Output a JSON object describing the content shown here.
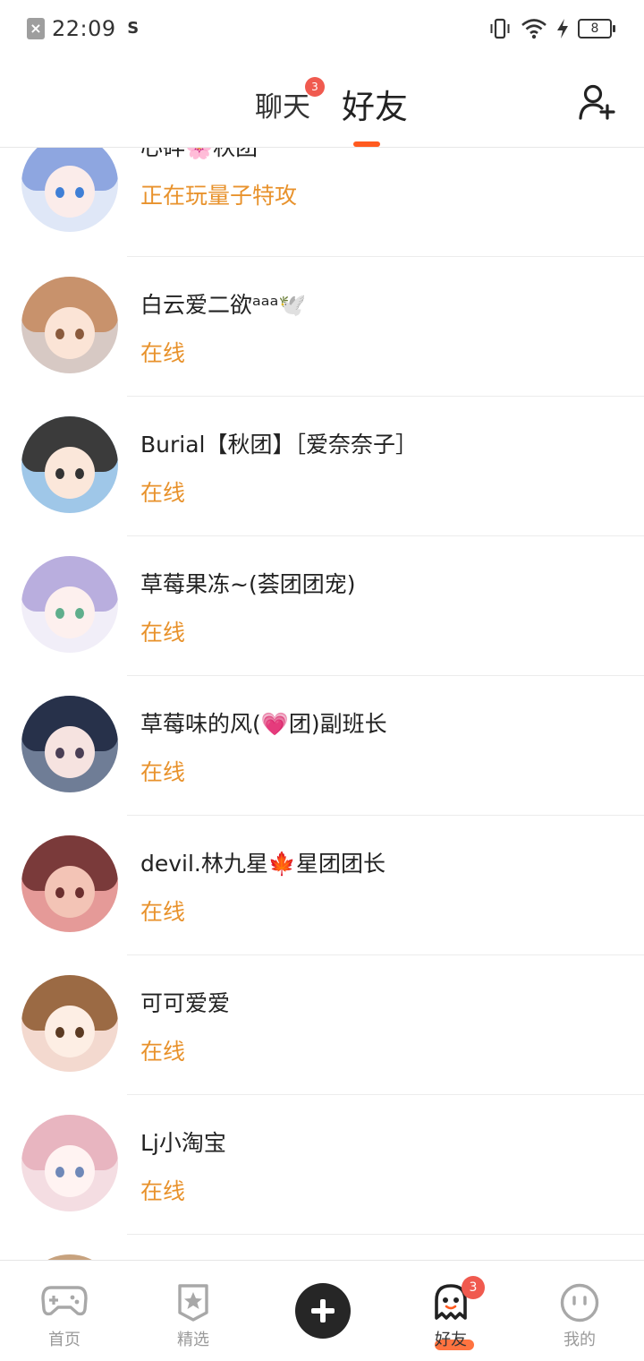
{
  "status_bar": {
    "time": "22:09",
    "battery": "8"
  },
  "header": {
    "tabs": [
      {
        "label": "聊天",
        "badge": "3",
        "active": false
      },
      {
        "label": "好友",
        "active": true
      }
    ],
    "add_friend_icon": "add-person-icon",
    "accent_color": "#ff5a1f"
  },
  "friends": [
    {
      "name": "心碎🌸秋团",
      "status": "正在玩量子特攻"
    },
    {
      "name": "白云爱二欲ᵃᵃᵃ🕊️",
      "status": "在线"
    },
    {
      "name": "Burial【秋团】［爱奈奈子］",
      "status": "在线"
    },
    {
      "name": "草莓果冻~(荟团团宠)",
      "status": "在线"
    },
    {
      "name": "草莓味的风(💗团)副班长",
      "status": "在线"
    },
    {
      "name": "devil.林九星🍁星团团长",
      "status": "在线"
    },
    {
      "name": "可可爱爱",
      "status": "在线"
    },
    {
      "name": "Lj小淘宝",
      "status": "在线"
    }
  ],
  "status_color": "#e8922c",
  "bottom_nav": {
    "items": [
      {
        "label": "首页",
        "icon": "gamepad-icon"
      },
      {
        "label": "精选",
        "icon": "star-badge-icon"
      },
      {
        "label": "",
        "icon": "plus-icon"
      },
      {
        "label": "好友",
        "icon": "ghost-icon",
        "badge": "3",
        "active": true
      },
      {
        "label": "我的",
        "icon": "face-icon"
      }
    ]
  }
}
